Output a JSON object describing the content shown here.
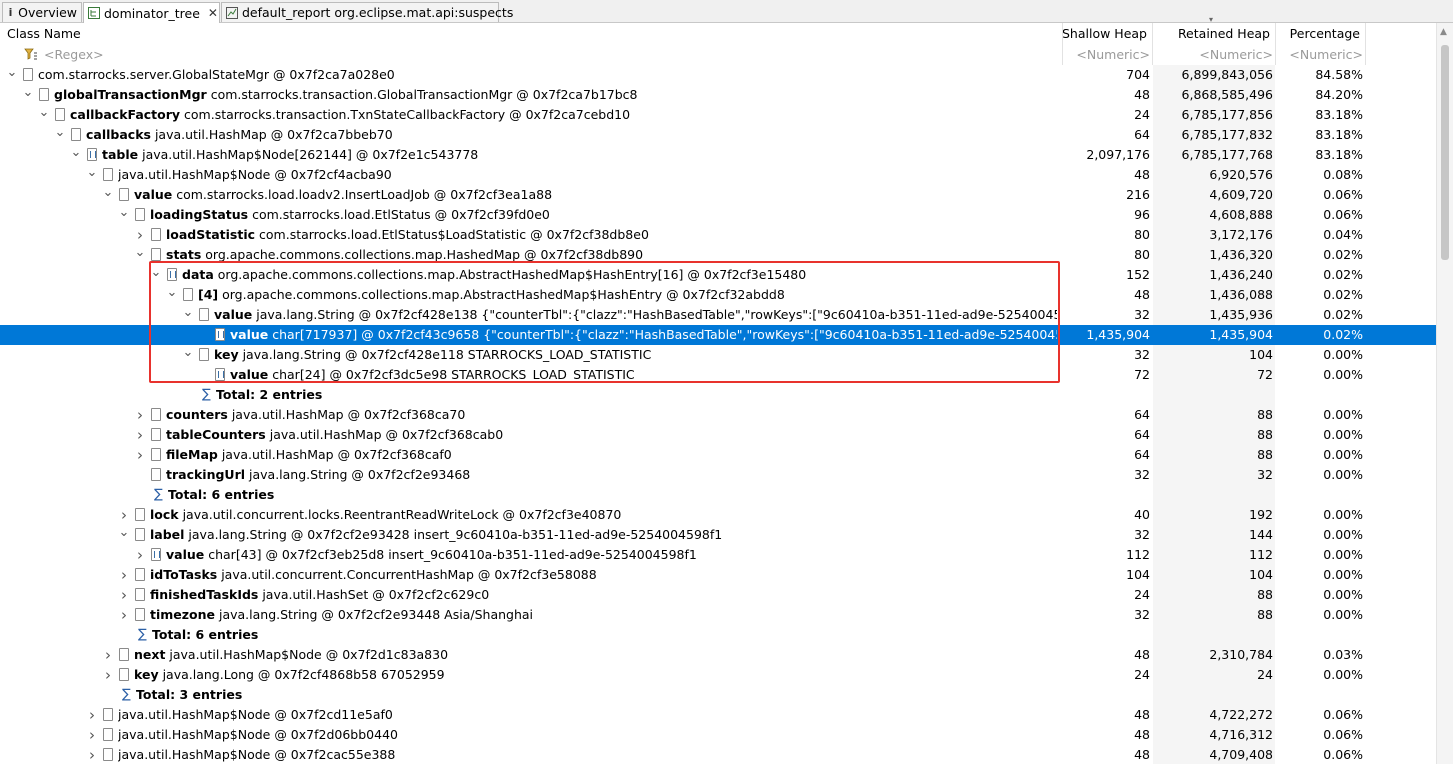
{
  "tabs": [
    {
      "label": "Overview",
      "icon": "info-icon"
    },
    {
      "label": "dominator_tree",
      "icon": "tree-icon",
      "active": true
    },
    {
      "label": "default_report  org.eclipse.mat.api:suspects",
      "icon": "report-icon"
    }
  ],
  "columns": {
    "class_name": "Class Name",
    "shallow": "Shallow Heap",
    "retained": "Retained Heap",
    "percentage": "Percentage"
  },
  "filters": {
    "class_name": "<Regex>",
    "shallow": "<Numeric>",
    "retained": "<Numeric>",
    "percentage": "<Numeric>"
  },
  "rows": [
    {
      "d": 0,
      "t": "v",
      "i": "obj",
      "bold": "",
      "rest": "com.starrocks.server.GlobalStateMgr @ 0x7f2ca7a028e0",
      "s": "704",
      "r": "6,899,843,056",
      "p": "84.58%"
    },
    {
      "d": 1,
      "t": "v",
      "i": "obj",
      "bold": "globalTransactionMgr",
      "rest": " com.starrocks.transaction.GlobalTransactionMgr @ 0x7f2ca7b17bc8",
      "s": "48",
      "r": "6,868,585,496",
      "p": "84.20%"
    },
    {
      "d": 2,
      "t": "v",
      "i": "obj",
      "bold": "callbackFactory",
      "rest": " com.starrocks.transaction.TxnStateCallbackFactory @ 0x7f2ca7cebd10",
      "s": "24",
      "r": "6,785,177,856",
      "p": "83.18%"
    },
    {
      "d": 3,
      "t": "v",
      "i": "obj",
      "bold": "callbacks",
      "rest": " java.util.HashMap @ 0x7f2ca7bbeb70",
      "s": "64",
      "r": "6,785,177,832",
      "p": "83.18%"
    },
    {
      "d": 4,
      "t": "v",
      "i": "arr",
      "bold": "table",
      "rest": " java.util.HashMap$Node[262144] @ 0x7f2e1c543778",
      "s": "2,097,176",
      "r": "6,785,177,768",
      "p": "83.18%"
    },
    {
      "d": 5,
      "t": "v",
      "i": "obj",
      "bold": "",
      "rest": "java.util.HashMap$Node @ 0x7f2cf4acba90",
      "s": "48",
      "r": "6,920,576",
      "p": "0.08%"
    },
    {
      "d": 6,
      "t": "v",
      "i": "obj",
      "bold": "value",
      "rest": " com.starrocks.load.loadv2.InsertLoadJob @ 0x7f2cf3ea1a88",
      "s": "216",
      "r": "4,609,720",
      "p": "0.06%"
    },
    {
      "d": 7,
      "t": "v",
      "i": "obj",
      "bold": "loadingStatus",
      "rest": " com.starrocks.load.EtlStatus @ 0x7f2cf39fd0e0",
      "s": "96",
      "r": "4,608,888",
      "p": "0.06%"
    },
    {
      "d": 8,
      "t": ">",
      "i": "obj",
      "bold": "loadStatistic",
      "rest": " com.starrocks.load.EtlStatus$LoadStatistic @ 0x7f2cf38db8e0",
      "s": "80",
      "r": "3,172,176",
      "p": "0.04%"
    },
    {
      "d": 8,
      "t": "v",
      "i": "obj",
      "bold": "stats",
      "rest": " org.apache.commons.collections.map.HashedMap @ 0x7f2cf38db890",
      "s": "80",
      "r": "1,436,320",
      "p": "0.02%"
    },
    {
      "d": 9,
      "t": "v",
      "i": "arr",
      "bold": "data",
      "rest": " org.apache.commons.collections.map.AbstractHashedMap$HashEntry[16] @ 0x7f2cf3e15480",
      "s": "152",
      "r": "1,436,240",
      "p": "0.02%"
    },
    {
      "d": 10,
      "t": "v",
      "i": "obj",
      "bold": "[4]",
      "rest": " org.apache.commons.collections.map.AbstractHashedMap$HashEntry @ 0x7f2cf32abdd8",
      "s": "48",
      "r": "1,436,088",
      "p": "0.02%"
    },
    {
      "d": 11,
      "t": "v",
      "i": "obj",
      "bold": "value",
      "rest": " java.lang.String @ 0x7f2cf428e138  {\"counterTbl\":{\"clazz\":\"HashBasedTable\",\"rowKeys\":[\"9c60410a-b351-11ed-ad9e-5254004598f1\"],\"colum",
      "s": "32",
      "r": "1,435,936",
      "p": "0.02%"
    },
    {
      "d": 12,
      "t": "",
      "i": "arr",
      "bold": "value",
      "rest": " char[717937] @ 0x7f2cf43c9658  {\"counterTbl\":{\"clazz\":\"HashBasedTable\",\"rowKeys\":[\"9c60410a-b351-11ed-ad9e-5254004598f1\"],\"colum",
      "s": "1,435,904",
      "r": "1,435,904",
      "p": "0.02%",
      "sel": true
    },
    {
      "d": 11,
      "t": "v",
      "i": "obj",
      "bold": "key",
      "rest": " java.lang.String @ 0x7f2cf428e118  STARROCKS_LOAD_STATISTIC",
      "s": "32",
      "r": "104",
      "p": "0.00%"
    },
    {
      "d": 12,
      "t": "",
      "i": "arr",
      "bold": "value",
      "rest": " char[24] @ 0x7f2cf3dc5e98  STARROCKS_LOAD_STATISTIC",
      "s": "72",
      "r": "72",
      "p": "0.00%"
    },
    {
      "d": 11,
      "t": "",
      "i": "sum",
      "bold": "Total: 2 entries",
      "rest": "",
      "s": "",
      "r": "",
      "p": ""
    },
    {
      "d": 8,
      "t": ">",
      "i": "obj",
      "bold": "counters",
      "rest": " java.util.HashMap @ 0x7f2cf368ca70",
      "s": "64",
      "r": "88",
      "p": "0.00%"
    },
    {
      "d": 8,
      "t": ">",
      "i": "obj",
      "bold": "tableCounters",
      "rest": " java.util.HashMap @ 0x7f2cf368cab0",
      "s": "64",
      "r": "88",
      "p": "0.00%"
    },
    {
      "d": 8,
      "t": ">",
      "i": "obj",
      "bold": "fileMap",
      "rest": " java.util.HashMap @ 0x7f2cf368caf0",
      "s": "64",
      "r": "88",
      "p": "0.00%"
    },
    {
      "d": 8,
      "t": "",
      "i": "obj",
      "bold": "trackingUrl",
      "rest": " java.lang.String @ 0x7f2cf2e93468",
      "s": "32",
      "r": "32",
      "p": "0.00%"
    },
    {
      "d": 8,
      "t": "",
      "i": "sum",
      "bold": "Total: 6 entries",
      "rest": "",
      "s": "",
      "r": "",
      "p": ""
    },
    {
      "d": 7,
      "t": ">",
      "i": "obj",
      "bold": "lock",
      "rest": " java.util.concurrent.locks.ReentrantReadWriteLock @ 0x7f2cf3e40870",
      "s": "40",
      "r": "192",
      "p": "0.00%"
    },
    {
      "d": 7,
      "t": "v",
      "i": "obj",
      "bold": "label",
      "rest": " java.lang.String @ 0x7f2cf2e93428  insert_9c60410a-b351-11ed-ad9e-5254004598f1",
      "s": "32",
      "r": "144",
      "p": "0.00%"
    },
    {
      "d": 8,
      "t": ">",
      "i": "arr",
      "bold": "value",
      "rest": " char[43] @ 0x7f2cf3eb25d8  insert_9c60410a-b351-11ed-ad9e-5254004598f1",
      "s": "112",
      "r": "112",
      "p": "0.00%"
    },
    {
      "d": 7,
      "t": ">",
      "i": "obj",
      "bold": "idToTasks",
      "rest": " java.util.concurrent.ConcurrentHashMap @ 0x7f2cf3e58088",
      "s": "104",
      "r": "104",
      "p": "0.00%"
    },
    {
      "d": 7,
      "t": ">",
      "i": "obj",
      "bold": "finishedTaskIds",
      "rest": " java.util.HashSet @ 0x7f2cf2c629c0",
      "s": "24",
      "r": "88",
      "p": "0.00%"
    },
    {
      "d": 7,
      "t": ">",
      "i": "obj",
      "bold": "timezone",
      "rest": " java.lang.String @ 0x7f2cf2e93448  Asia/Shanghai",
      "s": "32",
      "r": "88",
      "p": "0.00%"
    },
    {
      "d": 7,
      "t": "",
      "i": "sum",
      "bold": "Total: 6 entries",
      "rest": "",
      "s": "",
      "r": "",
      "p": ""
    },
    {
      "d": 6,
      "t": ">",
      "i": "obj",
      "bold": "next",
      "rest": " java.util.HashMap$Node @ 0x7f2d1c83a830",
      "s": "48",
      "r": "2,310,784",
      "p": "0.03%"
    },
    {
      "d": 6,
      "t": ">",
      "i": "obj",
      "bold": "key",
      "rest": " java.lang.Long @ 0x7f2cf4868b58  67052959",
      "s": "24",
      "r": "24",
      "p": "0.00%"
    },
    {
      "d": 6,
      "t": "",
      "i": "sum",
      "bold": "Total: 3 entries",
      "rest": "",
      "s": "",
      "r": "",
      "p": ""
    },
    {
      "d": 5,
      "t": ">",
      "i": "obj",
      "bold": "",
      "rest": "java.util.HashMap$Node @ 0x7f2cd11e5af0",
      "s": "48",
      "r": "4,722,272",
      "p": "0.06%"
    },
    {
      "d": 5,
      "t": ">",
      "i": "obj",
      "bold": "",
      "rest": "java.util.HashMap$Node @ 0x7f2d06bb0440",
      "s": "48",
      "r": "4,716,312",
      "p": "0.06%"
    },
    {
      "d": 5,
      "t": ">",
      "i": "obj",
      "bold": "",
      "rest": "java.util.HashMap$Node @ 0x7f2cac55e388",
      "s": "48",
      "r": "4,709,408",
      "p": "0.06%"
    }
  ],
  "colors": {
    "selection": "#0078d7",
    "highlight_box": "#e8322d"
  }
}
